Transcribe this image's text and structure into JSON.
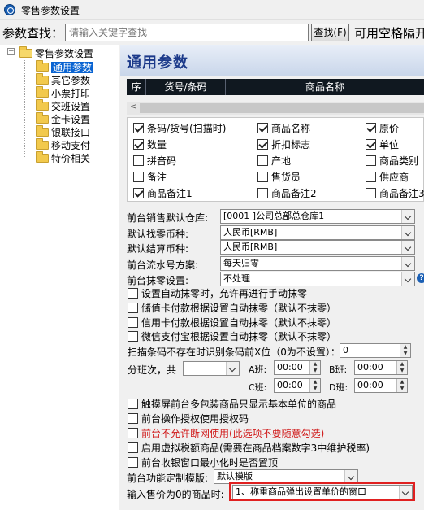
{
  "window": {
    "title": "零售参数设置"
  },
  "search": {
    "label": "参数查找：",
    "placeholder": "请输入关键字查找",
    "button_label": "查找(F)",
    "hint": "可用空格隔开"
  },
  "tree": {
    "root_label": "零售参数设置",
    "items": [
      {
        "label": "通用参数",
        "selected": true
      },
      {
        "label": "其它参数",
        "selected": false
      },
      {
        "label": "小票打印",
        "selected": false
      },
      {
        "label": "交班设置",
        "selected": false
      },
      {
        "label": "金卡设置",
        "selected": false
      },
      {
        "label": "银联接口",
        "selected": false
      },
      {
        "label": "移动支付",
        "selected": false
      },
      {
        "label": "特价相关",
        "selected": false
      }
    ]
  },
  "main": {
    "title": "通用参数",
    "grid_headers": [
      "序",
      "货号/条码",
      "商品名称"
    ],
    "scroll_left_symbol": "<",
    "checkboxes": [
      {
        "label": "条码/货号(扫描时)",
        "checked": true
      },
      {
        "label": "商品名称",
        "checked": true
      },
      {
        "label": "原价",
        "checked": true
      },
      {
        "label": "数量",
        "checked": true
      },
      {
        "label": "折扣标志",
        "checked": true
      },
      {
        "label": "单位",
        "checked": true
      },
      {
        "label": "拼音码",
        "checked": false
      },
      {
        "label": "产地",
        "checked": false
      },
      {
        "label": "商品类别",
        "checked": false
      },
      {
        "label": "备注",
        "checked": false
      },
      {
        "label": "售货员",
        "checked": false
      },
      {
        "label": "供应商",
        "checked": false
      },
      {
        "label": "商品备注1",
        "checked": true
      },
      {
        "label": "商品备注2",
        "checked": false
      },
      {
        "label": "商品备注3",
        "checked": false
      }
    ],
    "form": {
      "warehouse_label": "前台销售默认仓库:",
      "warehouse_value": "[0001    ]公司总部总仓库1",
      "change_currency_label": "默认找零币种:",
      "change_currency_value": "人民币[RMB]",
      "settle_currency_label": "默认结算币种:",
      "settle_currency_value": "人民币[RMB]",
      "serial_label": "前台流水号方案:",
      "serial_value": "每天归零",
      "rounding_label": "前台抹零设置:",
      "rounding_value": "不处理",
      "help_symbol": "?",
      "options_a": [
        {
          "label": "设置自动抹零时，允许再进行手动抹零",
          "checked": false
        },
        {
          "label": "储值卡付款根据设置自动抹零（默认不抹零）",
          "checked": false
        },
        {
          "label": "信用卡付款根据设置自动抹零（默认不抹零）",
          "checked": false
        },
        {
          "label": "微信支付宝根据设置自动抹零（默认不抹零）",
          "checked": false
        }
      ],
      "scan_label": "扫描条码不存在时识别条码前X位（0为不设置）：",
      "scan_value": "0",
      "shift_label": "分班次，共",
      "shift_count": "",
      "shift_a_label": "A班:",
      "shift_a_value": "00:00",
      "shift_b_label": "B班:",
      "shift_b_value": "00:00",
      "shift_c_label": "C班:",
      "shift_c_value": "00:00",
      "shift_d_label": "D班:",
      "shift_d_value": "00:00",
      "options_b": [
        {
          "label": "触摸屏前台多包装商品只显示基本单位的商品",
          "checked": false,
          "red": false
        },
        {
          "label": "前台操作授权使用授权码",
          "checked": false,
          "red": false
        },
        {
          "label": "前台不允许断网使用(此选项不要随意勾选)",
          "checked": false,
          "red": true
        },
        {
          "label": "启用虚拟税额商品(需要在商品档案数字3中维护税率)",
          "checked": false,
          "red": false
        },
        {
          "label": "前台收银窗口最小化时是否置顶",
          "checked": false,
          "red": false
        }
      ],
      "template_label": "前台功能定制模版:",
      "template_value": "默认模版",
      "zero_price_label": "输入售价为0的商品时:",
      "zero_price_value": "1、称重商品弹出设置单价的窗口"
    }
  },
  "colors": {
    "accent": "#1c3a8a",
    "highlight": "#e02020",
    "selection": "#0a64d2",
    "warning_text": "#d01818"
  }
}
